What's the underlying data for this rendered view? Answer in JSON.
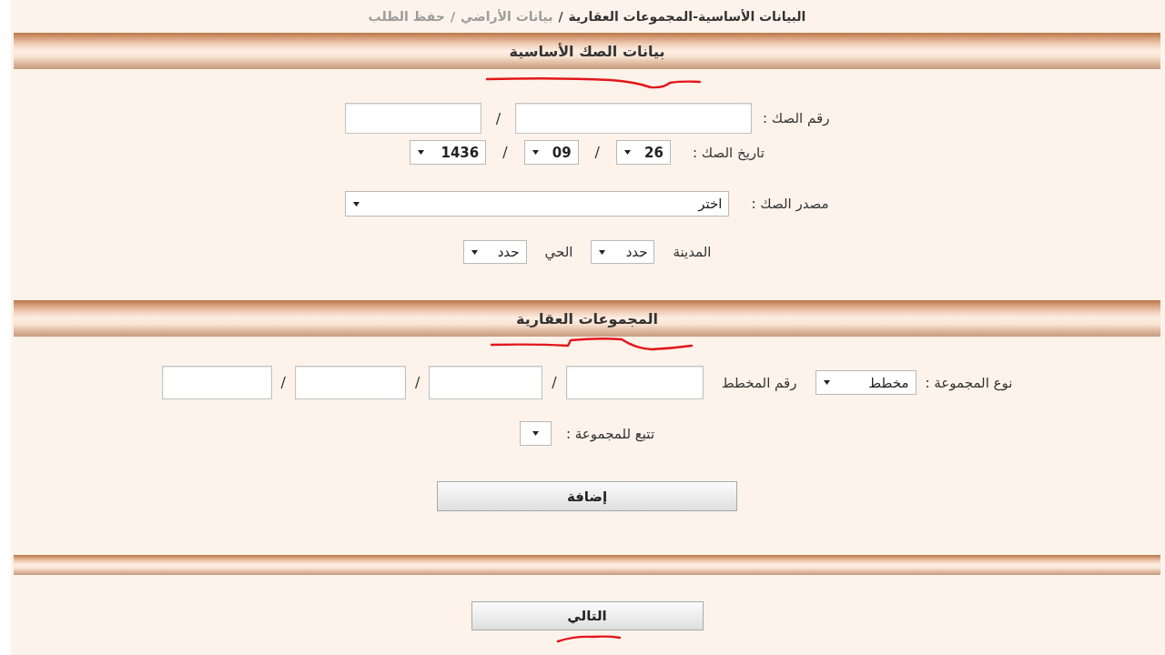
{
  "breadcrumb": [
    {
      "label": "البيانات الأساسية-المجموعات العقارية",
      "selected": true,
      "separator": "/"
    },
    {
      "label": "بيانات الأراضي",
      "selected": false,
      "separator": "/"
    },
    {
      "label": "حفظ الطلب",
      "selected": false
    }
  ],
  "deed_section": {
    "title": {
      "text": "بيانات الصك الأساسية",
      "marked": true
    },
    "deed_number": {
      "label": "رقم الصك :",
      "separator": "/"
    },
    "deed_date": {
      "label": "تاريخ الصك :",
      "day": "26",
      "month": "09",
      "year": "1436",
      "separators": [
        "/",
        "/"
      ]
    },
    "deed_source": {
      "label": "مصدر الصك :",
      "value": "اختر"
    },
    "city": {
      "label": "المدينة",
      "value": "حدد"
    },
    "district": {
      "label": "الحي",
      "value": "حدد"
    }
  },
  "groups_section": {
    "title": {
      "text": "المجموعات العقارية",
      "marked": true
    },
    "group_type": {
      "label": "نوع المجموعة :",
      "value": "مخطط"
    },
    "plan_number": {
      "label": "رقم المخطط",
      "separators": [
        "/",
        "/",
        "/"
      ]
    },
    "parent_group": {
      "label": "تتبع للمجموعة :"
    },
    "add_button": "إضافة"
  },
  "next_button": {
    "label": "التالي",
    "marked": true
  }
}
